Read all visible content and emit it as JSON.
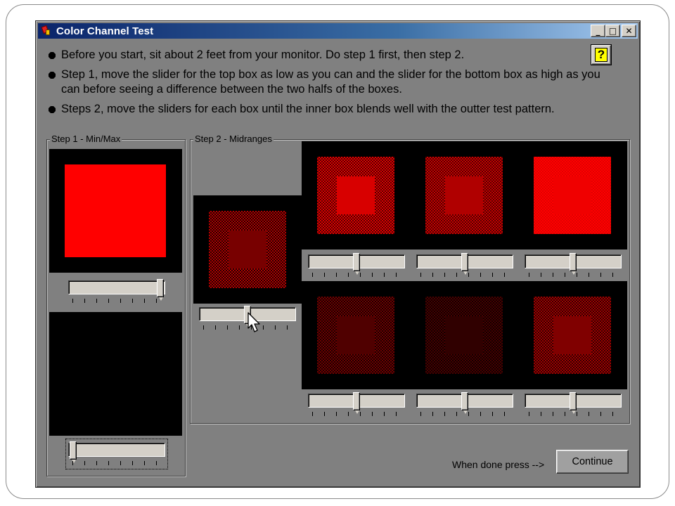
{
  "window": {
    "title": "Color Channel Test",
    "minimize_glyph": "_",
    "maximize_glyph": "□",
    "close_glyph": "✕"
  },
  "instructions": [
    "Before you start, sit about 2 feet from your monitor.  Do step 1 first, then step 2.",
    "Step 1, move the slider for the top box as low as you can and the slider for the bottom box as high as you can before seeing a difference between the two halfs of the boxes.",
    "Steps 2, move the sliders for each box until the inner box blends well with the outter test pattern."
  ],
  "help": {
    "glyph": "?"
  },
  "step1": {
    "label": "Step 1 - Min/Max",
    "top_slider_level": 1.0,
    "bottom_slider_level": 0.0
  },
  "step2": {
    "label": "Step 2 - Midranges",
    "slider_levels": [
      0.5,
      0.5,
      0.5,
      0.5,
      0.5,
      0.5,
      0.5
    ]
  },
  "footer": {
    "done_label": "When done press -->",
    "continue_label": "Continue"
  },
  "colors": {
    "window_bg": "#808080",
    "title_start": "#0a246a",
    "title_end": "#a6caf0",
    "red": "#ff0000"
  }
}
